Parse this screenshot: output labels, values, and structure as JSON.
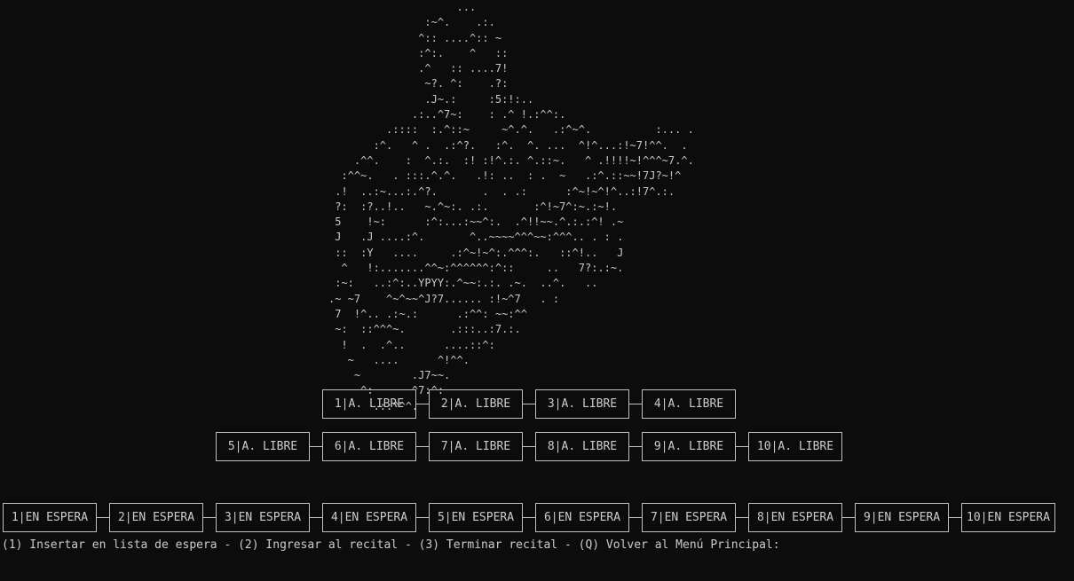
{
  "console": {
    "ascii_art": "                    ...\n               :~^.    .:.\n              ^:: ....^:: ~\n              :^:.    ^   ::\n              .^   :: ....7!\n               ~?. ^:    .?:\n               .J~.:     :5:!:..\n             .:..^7~:    : .^ !.:^^:.\n         .::::  :.^::~     ~^.^.   .:^~^.          :... .\n       :^.   ^ .  .:^?.   :^.  ^. ...  ^!^...:!~7!^^.  .\n    .^^.    :  ^.:.  :! :!^.:. ^.::~.   ^ .!!!!~!^^^~7.^.\n  :^^~.   . :::.^.^.   .!: ..  : .  ~   .:^.::~~!7J?~!^\n .!  ..:~...:.^?.       .  . .:      :^~!~^!^..:!7^.:.\n ?:  :?..!..   ~.^~:. .:.       :^!~7^:~.:~!.\n 5    !~:      :^:...:~~^:.  .^!!~~.^.:.:^! .~\n J   .J ....:^.       ^..~~~~^^^~~:^^^.. . : .\n ::  :Y   ....     .:^~!~^:.^^^:.   ::^!..   J\n  ^   !:.......^^~:^^^^^^:^::     ..   7?:.:~.\n :~:   ..:^:..YPYY:.^~~:.:. .~.  ..^.   ..\n.~ ~7    ^~^~~^J?7...... :!~^7   . :\n 7  !^.. .:~.:      .:^^: ~~:^^\n ~:  ::^^^~.       .:::..:7.:.\n  !  .  .^..      ....::^:\n   ~   ....      ^!^^.\n    ~        .J7~~.\n     ^:      ^7:^:\n       .::^^^.",
    "waiting_boxes_top": [
      "1|A. LIBRE",
      "2|A. LIBRE",
      "3|A. LIBRE",
      "4|A. LIBRE"
    ],
    "waiting_boxes_mid": [
      "5|A. LIBRE",
      "6|A. LIBRE",
      "7|A. LIBRE",
      "8|A. LIBRE",
      "9|A. LIBRE",
      "10|A. LIBRE"
    ],
    "queue_boxes": [
      "1|EN ESPERA",
      "2|EN ESPERA",
      "3|EN ESPERA",
      "4|EN ESPERA",
      "5|EN ESPERA",
      "6|EN ESPERA",
      "7|EN ESPERA",
      "8|EN ESPERA",
      "9|EN ESPERA",
      "10|EN ESPERA"
    ],
    "prompt": "(1) Insertar en lista de espera - (2) Ingresar al recital - (3) Terminar recital - (Q) Volver al Menú Principal:",
    "colors": {
      "background": "#0c0c0c",
      "foreground": "#cccccc"
    }
  }
}
